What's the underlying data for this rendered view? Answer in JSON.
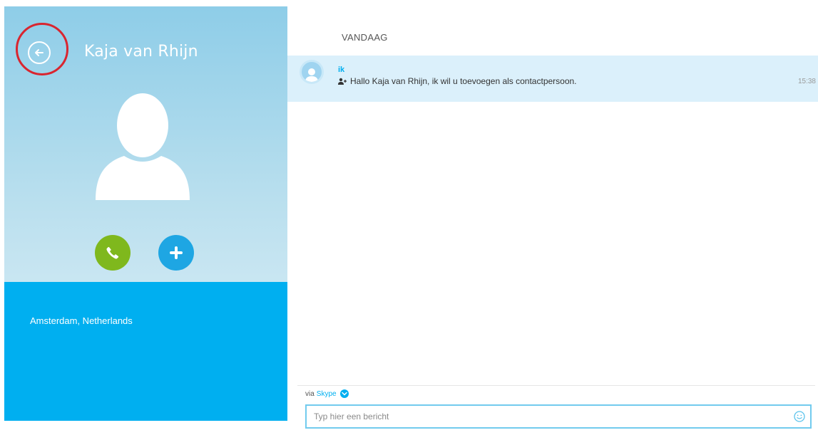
{
  "contact": {
    "name": "Kaja van Rhijn",
    "location": "Amsterdam, Netherlands"
  },
  "icons": {
    "back": "back-arrow-icon",
    "avatar": "person-silhouette-icon",
    "call": "phone-icon",
    "add": "plus-icon",
    "add_contact": "add-contact-icon",
    "emoji": "smiley-icon",
    "dropdown": "chevron-down-icon"
  },
  "conversation": {
    "date_label": "VANDAAG",
    "messages": [
      {
        "sender": "ik",
        "text": "Hallo Kaja van Rhijn, ik wil u toevoegen als contactpersoon.",
        "time": "15:38"
      }
    ]
  },
  "compose": {
    "via_prefix": "via",
    "via_service": "Skype",
    "placeholder": "Typ hier een bericht"
  },
  "colors": {
    "skype_blue": "#00aff0",
    "call_green": "#7fb81d",
    "add_blue": "#1ea6e3",
    "highlight_red": "#d9252f",
    "message_bg": "#dbf0fb"
  }
}
